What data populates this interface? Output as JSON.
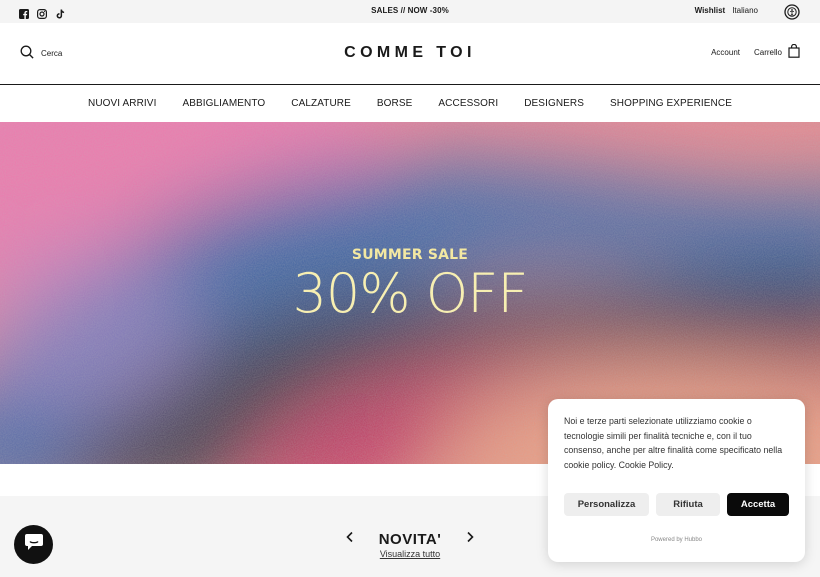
{
  "topbar": {
    "social_icons": [
      "facebook-icon",
      "instagram-icon",
      "tiktok-icon"
    ],
    "announcement": "SALES // NOW -30%",
    "wishlist": "Wishlist",
    "language": "Italiano",
    "language_icon": "accessibility-icon"
  },
  "header": {
    "search_label": "Cerca",
    "logo": "COMME TOI",
    "account": "Account",
    "cart": "Carrello"
  },
  "nav": {
    "items": [
      "NUOVI ARRIVI",
      "ABBIGLIAMENTO",
      "CALZATURE",
      "BORSE",
      "ACCESSORI",
      "DESIGNERS",
      "SHOPPING EXPERIENCE"
    ]
  },
  "hero": {
    "subtitle": "SUMMER SALE",
    "title": "30% OFF",
    "colors": {
      "pink": "#e9709a",
      "blue": "#2f5b96",
      "dark": "#3a3a44",
      "magenta": "#c2385f",
      "peach": "#e8967e",
      "text": "#f6edb0"
    }
  },
  "section": {
    "title": "NOVITA'",
    "link": "Visualizza tutto"
  },
  "cookie": {
    "text": "Noi e terze parti selezionate utilizziamo cookie o tecnologie simili per finalità tecniche e, con il tuo consenso, anche per altre finalità come specificato nella cookie policy. Cookie Policy.",
    "customize": "Personalizza",
    "reject": "Rifiuta",
    "accept": "Accetta",
    "powered": "Powered by Hubbo"
  },
  "chat": {
    "icon": "chat-icon"
  }
}
